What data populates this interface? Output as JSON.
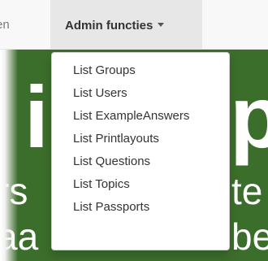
{
  "navbar": {
    "partial_item_label": "en",
    "open_menu_label": "Admin functies"
  },
  "dropdown": {
    "items": [
      {
        "label": "List Groups"
      },
      {
        "label": "List Users"
      },
      {
        "label": "List ExampleAnswers"
      },
      {
        "label": "List Printlayouts"
      },
      {
        "label": "List Questions"
      },
      {
        "label": "List Topics"
      },
      {
        "label": "List Passports"
      }
    ]
  },
  "hero": {
    "big_left": "i",
    "big_right": "p",
    "line1_left": "rs",
    "line1_right": "te",
    "line2_left": "aa",
    "line2_right": "be"
  },
  "colors": {
    "navbar_bg": "#f8f8f8",
    "open_item_bg": "#e7e7e7",
    "hero_bg": "#3c6e2b",
    "dropdown_text": "#333333"
  },
  "icons": {
    "caret": "chevron-down-icon"
  }
}
